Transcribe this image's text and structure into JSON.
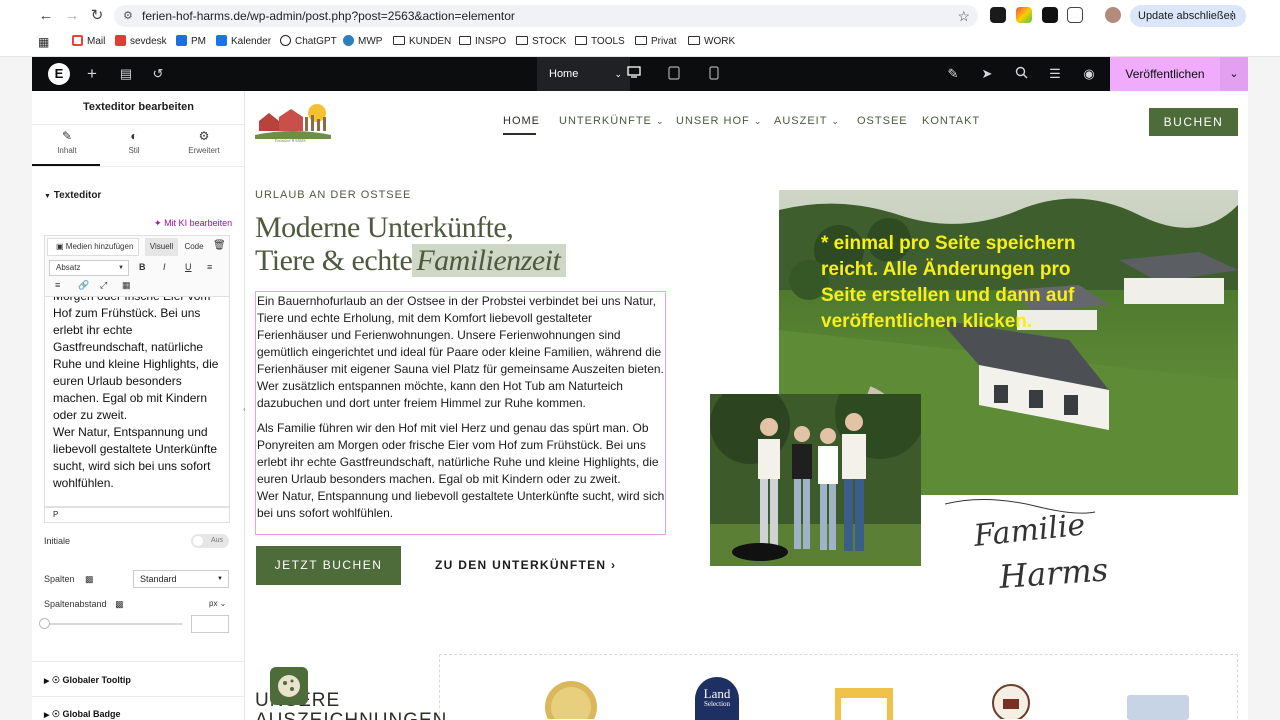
{
  "browser": {
    "url": "ferien-hof-harms.de/wp-admin/post.php?post=2563&action=elementor",
    "update_label": "Update abschließen",
    "bookmarks": [
      {
        "label": "Mail",
        "color": "#ea4335"
      },
      {
        "label": "sevdesk",
        "color": "#e53935"
      },
      {
        "label": "PM",
        "color": "#1e6fd9"
      },
      {
        "label": "Kalender",
        "color": "#1a73e8"
      },
      {
        "label": "ChatGPT",
        "color": "#222222"
      },
      {
        "label": "MWP",
        "color": "#2f7ebd"
      },
      {
        "label": "KUNDEN",
        "color": ""
      },
      {
        "label": "INSPO",
        "color": ""
      },
      {
        "label": "STOCK",
        "color": ""
      },
      {
        "label": "TOOLS",
        "color": ""
      },
      {
        "label": "Privat",
        "color": ""
      },
      {
        "label": "WORK",
        "color": ""
      }
    ]
  },
  "elementor_top": {
    "page_name": "Home",
    "publish_label": "Veröffentlichen",
    "accent": "#f0abfc"
  },
  "panel": {
    "title": "Texteditor bearbeiten",
    "tabs": [
      "Inhalt",
      "Stil",
      "Erweitert"
    ],
    "section": "Texteditor",
    "ki_label": "Mit KI bearbeiten",
    "media_label": "Medien hinzufügen",
    "visual_label": "Visuell",
    "code_label": "Code",
    "format_label": "Absatz",
    "editor_lines": [
      "Morgen oder frische Eier vom",
      "Hof zum Frühstück. Bei uns",
      "erlebt ihr echte",
      "Gastfreundschaft, natürliche",
      "Ruhe und kleine Highlights, die",
      "euren Urlaub besonders",
      "machen. Egal ob mit Kindern",
      "oder zu zweit.",
      "Wer Natur, Entspannung und",
      "liebevoll gestaltete Unterkünfte",
      "sucht, wird sich bei uns sofort",
      "wohlfühlen."
    ],
    "status_path": "P",
    "initiale_label": "Initiale",
    "initiale_toggle": "Aus",
    "spalten_label": "Spalten",
    "spalten_value": "Standard",
    "spaltenabstand_label": "Spaltenabstand",
    "spaltenabstand_unit": "px",
    "accordions": [
      "Globaler Tooltip",
      "Global Badge"
    ]
  },
  "site": {
    "brand_color": "#4e6b3a",
    "nav": [
      {
        "label": "HOME",
        "dropdown": false
      },
      {
        "label": "UNTERKÜNFTE",
        "dropdown": true
      },
      {
        "label": "UNSER HOF",
        "dropdown": true
      },
      {
        "label": "AUSZEIT",
        "dropdown": true
      },
      {
        "label": "OSTSEE",
        "dropdown": false
      },
      {
        "label": "KONTAKT",
        "dropdown": false
      }
    ],
    "buchen_label": "BUCHEN",
    "eyebrow": "URLAUB AN DER OSTSEE",
    "headline_line1": "Moderne Unterkünfte,",
    "headline_line2_plain": "Tiere & echte",
    "headline_line2_italic": "Familienzeit",
    "paragraph1": "Ein Bauernhofurlaub an der Ostsee in der Probstei verbindet bei uns Natur, Tiere und echte Erholung, mit dem Komfort liebevoll gestalteter Ferienhäuser und Ferienwohnungen. Unsere Ferienwohnungen sind gemütlich eingerichtet und ideal für Paare oder kleine Familien, während die Ferienhäuser mit eigener Sauna viel Platz für gemeinsame Auszeiten bieten. Wer zusätzlich entspannen möchte, kann den Hot Tub am Naturteich dazubuchen und dort unter freiem Himmel zur Ruhe kommen.",
    "paragraph2a": "Als Familie führen wir den Hof mit viel Herz und genau das spürt man. Ob Ponyreiten am Morgen oder frische Eier vom Hof zum Frühstück. Bei uns erlebt ihr echte Gastfreundschaft, natürliche Ruhe und kleine Highlights, die euren Urlaub besonders machen. Egal ob mit Kindern oder zu zweit.",
    "paragraph2b": "Wer Natur, Entspannung und liebevoll gestaltete Unterkünfte sucht, wird sich bei uns sofort wohlfühlen.",
    "cta_primary": "JETZT BUCHEN",
    "cta_secondary": "ZU DEN UNTERKÜNFTEN",
    "overlay_note": "* einmal pro Seite speichern reicht. Alle Änderungen pro Seite erstellen und dann auf veröffentlichen klicken.",
    "signature_line1": "Familie",
    "signature_line2": "Harms",
    "awards_title_line1": "UNSERE",
    "awards_title_line2": "AUSZEICHNUNGEN",
    "award_land_label": "Land",
    "award_land_sub": "Selection"
  }
}
